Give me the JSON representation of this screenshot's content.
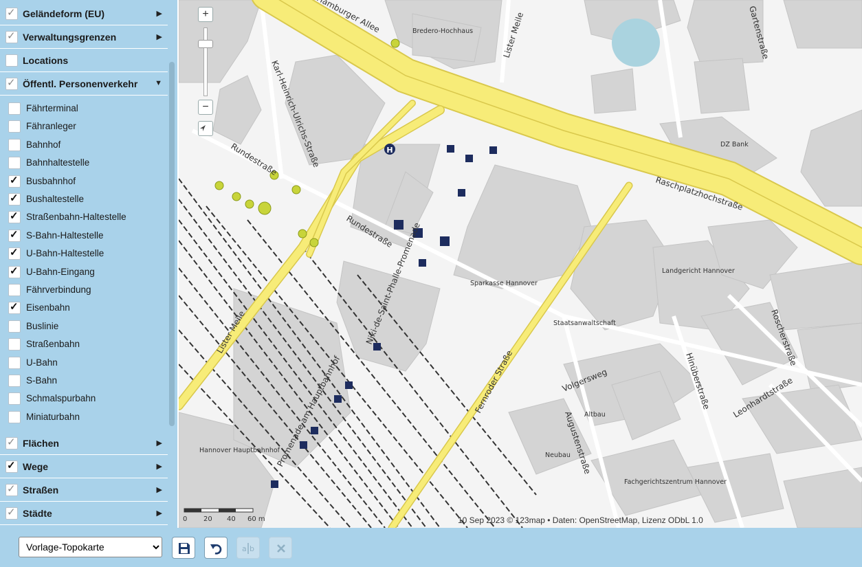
{
  "sidebar": {
    "groups_top": [
      {
        "label": "Geländeform (EU)",
        "checked": "light",
        "arrow": "▶"
      },
      {
        "label": "Verwaltungsgrenzen",
        "checked": "light",
        "arrow": "▶"
      },
      {
        "label": "Locations",
        "checked": "none",
        "arrow": ""
      },
      {
        "label": "Öffentl. Personenverkehr",
        "checked": "light",
        "arrow": "▼"
      }
    ],
    "sub_items": [
      {
        "label": "Fährterminal",
        "checked": false
      },
      {
        "label": "Fähranleger",
        "checked": false
      },
      {
        "label": "Bahnhof",
        "checked": false
      },
      {
        "label": "Bahnhaltestelle",
        "checked": false
      },
      {
        "label": "Busbahnhof",
        "checked": true
      },
      {
        "label": "Bushaltestelle",
        "checked": true
      },
      {
        "label": "Straßenbahn-Haltestelle",
        "checked": true
      },
      {
        "label": "S-Bahn-Haltestelle",
        "checked": true
      },
      {
        "label": "U-Bahn-Haltestelle",
        "checked": true
      },
      {
        "label": "U-Bahn-Eingang",
        "checked": true
      },
      {
        "label": "Fährverbindung",
        "checked": false
      },
      {
        "label": "Eisenbahn",
        "checked": true
      },
      {
        "label": "Buslinie",
        "checked": false
      },
      {
        "label": "Straßenbahn",
        "checked": false
      },
      {
        "label": "U-Bahn",
        "checked": false
      },
      {
        "label": "S-Bahn",
        "checked": false
      },
      {
        "label": "Schmalspurbahn",
        "checked": false
      },
      {
        "label": "Miniaturbahn",
        "checked": false
      }
    ],
    "groups_bottom": [
      {
        "label": "Flächen",
        "checked": "light",
        "arrow": "▶"
      },
      {
        "label": "Wege",
        "checked": "dark",
        "arrow": "▶"
      },
      {
        "label": "Straßen",
        "checked": "light",
        "arrow": "▶"
      },
      {
        "label": "Städte",
        "checked": "light",
        "arrow": "▶"
      }
    ]
  },
  "map": {
    "zoom_in": "+",
    "zoom_out": "−",
    "streets": {
      "hamburger_allee": "Hamburger Allee",
      "lister_meile_top": "Lister Meile",
      "gartenstrasse": "Gartenstraße",
      "karl_heinrich": "Karl-Heinrich-Ulrichs-Straße",
      "rundestrasse_1": "Rundestraße",
      "rundestrasse_2": "Rundestraße",
      "raschplatz": "Raschplatzhochstraße",
      "lister_meile": "Lister Meile",
      "niki": "Niki-de-Saint-Phalle-Promenade",
      "promenade": "Promenade am Hauptbahnhof",
      "fernroder": "Fernroder Straße",
      "volgersweg": "Volgersweg",
      "augustenstrasse": "Augustenstraße",
      "hinuberstrasse": "Hinüberstraße",
      "roscherstrasse": "Roscherstraße",
      "leonhardtstrasse": "Leonhardtstraße"
    },
    "places": {
      "bredero": "Bredero-Hochhaus",
      "dz_bank": "DZ Bank",
      "sparkasse": "Sparkasse Hannover",
      "landgericht": "Landgericht Hannover",
      "staatsanwaltschaft": "Staatsanwaltschaft",
      "altbau": "Altbau",
      "neubau": "Neubau",
      "fachgerichtszentrum": "Fachgerichtszentrum Hannover",
      "hauptbahnhof": "Hannover Hauptbahnhof"
    },
    "scale": {
      "t0": "0",
      "t1": "20",
      "t2": "40",
      "t3": "60 m"
    },
    "attribution": "10 Sep 2023 © 123map • Daten: OpenStreetMap, Lizenz ODbL 1.0",
    "colors": {
      "main_road": "#f7ec78",
      "road_edge": "#d9c84c",
      "building": "#d4d4d4",
      "water": "#aad3df",
      "transit_marker": "#1d2c5e",
      "bus_marker": "#c8d43a"
    }
  },
  "footer": {
    "template_selected": "Vorlage-Topokarte",
    "save_icon": "save-icon",
    "undo_icon": "undo-icon",
    "rename_icon": "rename-icon",
    "delete_icon": "close-icon"
  }
}
